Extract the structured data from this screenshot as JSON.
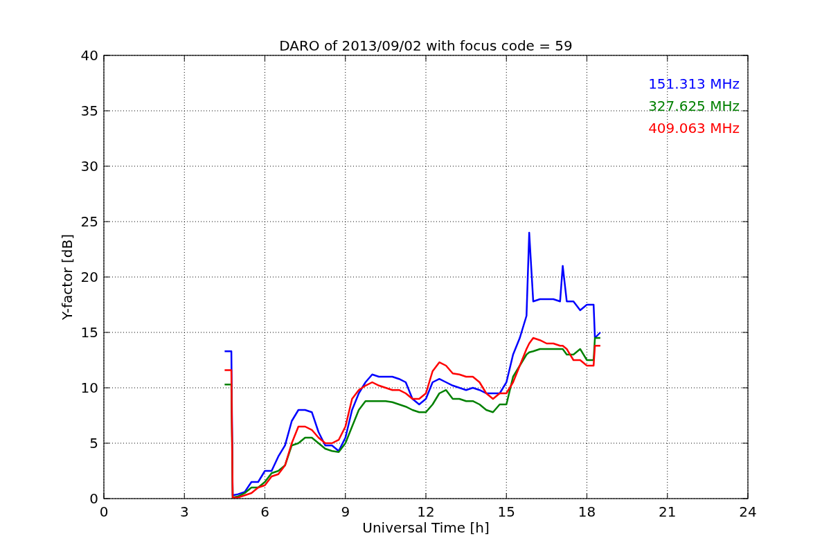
{
  "chart_data": {
    "type": "line",
    "title": "DARO of 2013/09/02 with focus code = 59",
    "xlabel": "Universal Time [h]",
    "ylabel": "Y-factor [dB]",
    "x": [
      4.5,
      4.75,
      4.8,
      5,
      5.25,
      5.5,
      5.75,
      6,
      6.25,
      6.5,
      6.75,
      7,
      7.25,
      7.5,
      7.75,
      8,
      8.25,
      8.5,
      8.75,
      9,
      9.25,
      9.5,
      9.75,
      10,
      10.25,
      10.5,
      10.75,
      11,
      11.25,
      11.5,
      11.75,
      12,
      12.25,
      12.5,
      12.75,
      13,
      13.25,
      13.5,
      13.75,
      14,
      14.25,
      14.5,
      14.75,
      15,
      15.25,
      15.5,
      15.75,
      15.85,
      16,
      16.25,
      16.5,
      16.75,
      17,
      17.1,
      17.25,
      17.5,
      17.75,
      18,
      18.25,
      18.3,
      18.5
    ],
    "series": [
      {
        "name": "151.313 MHz",
        "color": "#0000ff",
        "values": [
          13.3,
          13.3,
          0.3,
          0.4,
          0.6,
          1.5,
          1.5,
          2.5,
          2.5,
          3.8,
          4.8,
          7,
          8,
          8,
          7.8,
          6,
          4.8,
          4.8,
          4.3,
          5.5,
          8,
          9.5,
          10.5,
          11.2,
          11,
          11,
          11,
          10.8,
          10.5,
          9,
          8.5,
          9,
          10.5,
          10.8,
          10.5,
          10.2,
          10,
          9.8,
          10,
          9.8,
          9.5,
          9.5,
          9.5,
          10.5,
          13,
          14.5,
          16.5,
          24,
          17.8,
          18,
          18,
          18,
          17.8,
          21,
          17.8,
          17.8,
          17,
          17.5,
          17.5,
          14.5,
          15
        ]
      },
      {
        "name": "327.625 MHz",
        "color": "#008000",
        "values": [
          10.3,
          10.3,
          0.1,
          0.2,
          0.5,
          1,
          1,
          1.5,
          2.3,
          2.5,
          3,
          4.8,
          5,
          5.5,
          5.5,
          5,
          4.5,
          4.3,
          4.2,
          5,
          6.5,
          8,
          8.8,
          8.8,
          8.8,
          8.8,
          8.7,
          8.5,
          8.3,
          8,
          7.8,
          7.8,
          8.5,
          9.5,
          9.8,
          9,
          9,
          8.8,
          8.8,
          8.5,
          8,
          7.8,
          8.5,
          8.5,
          11,
          12,
          13,
          13.2,
          13.3,
          13.5,
          13.5,
          13.5,
          13.5,
          13.5,
          13,
          13,
          13.5,
          12.5,
          12.5,
          14.5,
          14.5
        ]
      },
      {
        "name": "409.063 MHz",
        "color": "#ff0000",
        "values": [
          11.6,
          11.6,
          0.1,
          0.1,
          0.3,
          0.5,
          1,
          1.2,
          2,
          2.2,
          3,
          5,
          6.5,
          6.5,
          6.2,
          5.5,
          5,
          5,
          5.3,
          6.5,
          9,
          9.8,
          10.2,
          10.5,
          10.2,
          10,
          9.8,
          9.8,
          9.5,
          9,
          9,
          9.5,
          11.5,
          12.3,
          12,
          11.3,
          11.2,
          11,
          11,
          10.5,
          9.5,
          9,
          9.5,
          9.5,
          10.5,
          12,
          13.5,
          14,
          14.5,
          14.3,
          14,
          14,
          13.8,
          13.8,
          13.5,
          12.5,
          12.5,
          12,
          12,
          13.8,
          13.8
        ]
      }
    ],
    "grid": true,
    "xlim": [
      0,
      24
    ],
    "ylim": [
      0,
      40
    ],
    "xticks": [
      0,
      3,
      6,
      9,
      12,
      15,
      18,
      21,
      24
    ],
    "yticks": [
      0,
      5,
      10,
      15,
      20,
      25,
      30,
      35,
      40
    ]
  }
}
